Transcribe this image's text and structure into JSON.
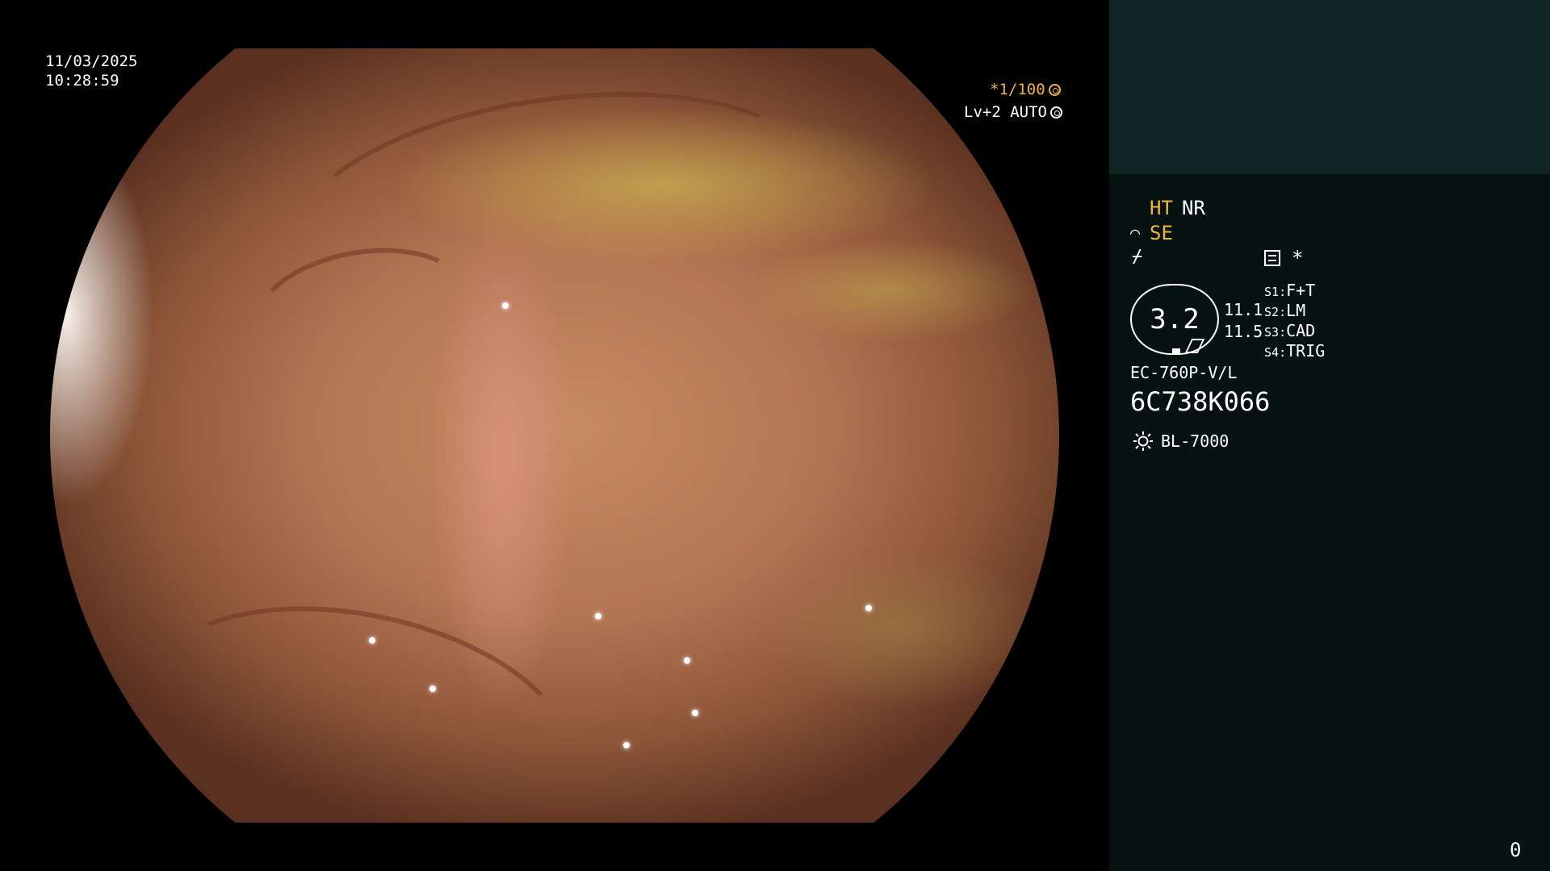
{
  "overlay": {
    "date": "11/03/2025",
    "time": "10:28:59",
    "shutter": "*1/100",
    "level": "Lv+2 AUTO"
  },
  "panel": {
    "modes": {
      "ht": "HT",
      "nr": "NR",
      "se": "SE",
      "wave_symbol": "⌒",
      "slash_symbol": "⌿",
      "asterisk": "*"
    },
    "zoom": {
      "value": "3.2",
      "upper": "11.1",
      "lower": "11.5"
    },
    "switches": [
      {
        "key": "S1",
        "value": "F+T"
      },
      {
        "key": "S2",
        "value": "LM"
      },
      {
        "key": "S3",
        "value": "CAD"
      },
      {
        "key": "S4",
        "value": "TRIG"
      }
    ],
    "scope_model": "EC-760P-V/L",
    "serial": "6C738K066",
    "light_source": "BL-7000",
    "counter": "0"
  },
  "colors": {
    "accent": "#f2b53a",
    "panel_bg": "#061311",
    "panel_top_bg": "#0f2624"
  }
}
